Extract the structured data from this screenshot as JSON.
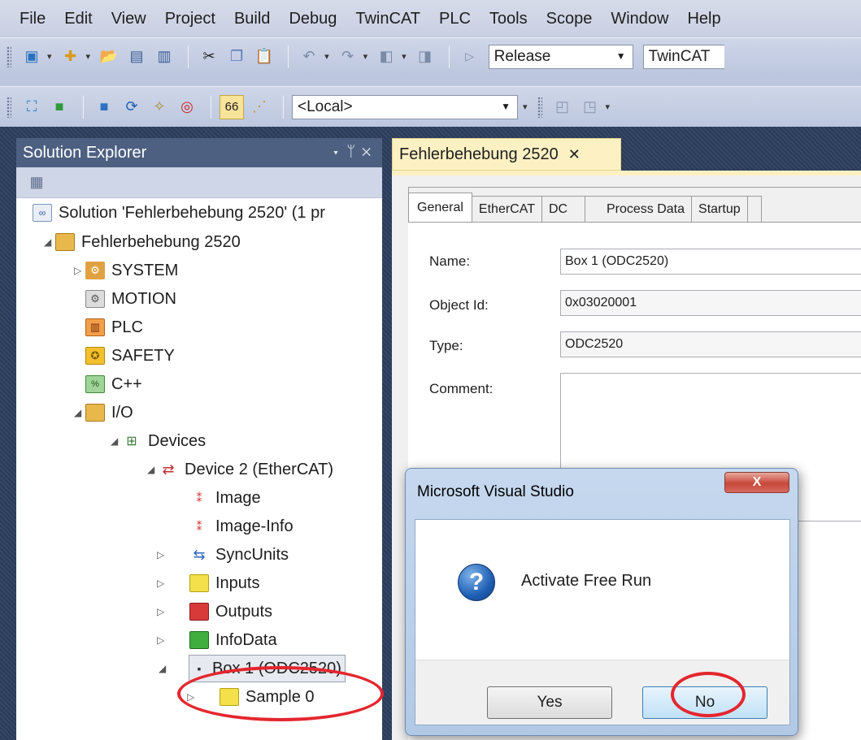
{
  "menu": [
    "File",
    "Edit",
    "View",
    "Project",
    "Build",
    "Debug",
    "TwinCAT",
    "PLC",
    "Tools",
    "Scope",
    "Window",
    "Help"
  ],
  "toolbar1": {
    "config_combo": "Release",
    "platform_combo": "TwinCAT"
  },
  "toolbar2": {
    "target_combo": "<Local>"
  },
  "solution_explorer": {
    "title": "Solution Explorer",
    "tree": [
      {
        "label": "Solution 'Fehlerbehebung 2520' (1 pr",
        "icon": "solution-icon"
      },
      {
        "label": "Fehlerbehebung 2520",
        "icon": "project-icon"
      },
      {
        "label": "SYSTEM",
        "icon": "system-icon"
      },
      {
        "label": "MOTION",
        "icon": "motion-icon"
      },
      {
        "label": "PLC",
        "icon": "plc-icon"
      },
      {
        "label": "SAFETY",
        "icon": "safety-icon"
      },
      {
        "label": "C++",
        "icon": "cpp-icon"
      },
      {
        "label": "I/O",
        "icon": "io-icon"
      },
      {
        "label": "Devices",
        "icon": "devices-icon"
      },
      {
        "label": "Device 2 (EtherCAT)",
        "icon": "ethercat-device-icon"
      },
      {
        "label": "Image",
        "icon": "image-icon"
      },
      {
        "label": "Image-Info",
        "icon": "image-info-icon"
      },
      {
        "label": "SyncUnits",
        "icon": "sync-units-icon"
      },
      {
        "label": "Inputs",
        "icon": "inputs-icon"
      },
      {
        "label": "Outputs",
        "icon": "outputs-icon"
      },
      {
        "label": "InfoData",
        "icon": "infodata-icon"
      },
      {
        "label": "Box 1 (ODC2520)",
        "icon": "box-icon"
      },
      {
        "label": "Sample 0",
        "icon": "sample-icon"
      }
    ]
  },
  "document": {
    "tab_title": "Fehlerbehebung 2520",
    "tabs": [
      "General",
      "EtherCAT",
      "DC",
      "Process Data",
      "Startup",
      ""
    ],
    "fields": {
      "name_label": "Name:",
      "name_value": "Box 1 (ODC2520)",
      "objectid_label": "Object Id:",
      "objectid_value": "0x03020001",
      "type_label": "Type:",
      "type_value": "ODC2520",
      "comment_label": "Comment:",
      "comment_value": ""
    }
  },
  "dialog": {
    "title": "Microsoft Visual Studio",
    "message": "Activate Free Run",
    "yes_label": "Yes",
    "no_label": "No",
    "close_glyph": "X"
  },
  "colors": {
    "annotation": "#e4262e",
    "tab_active": "#fdf1c4",
    "explorer_title": "#4d6082"
  }
}
